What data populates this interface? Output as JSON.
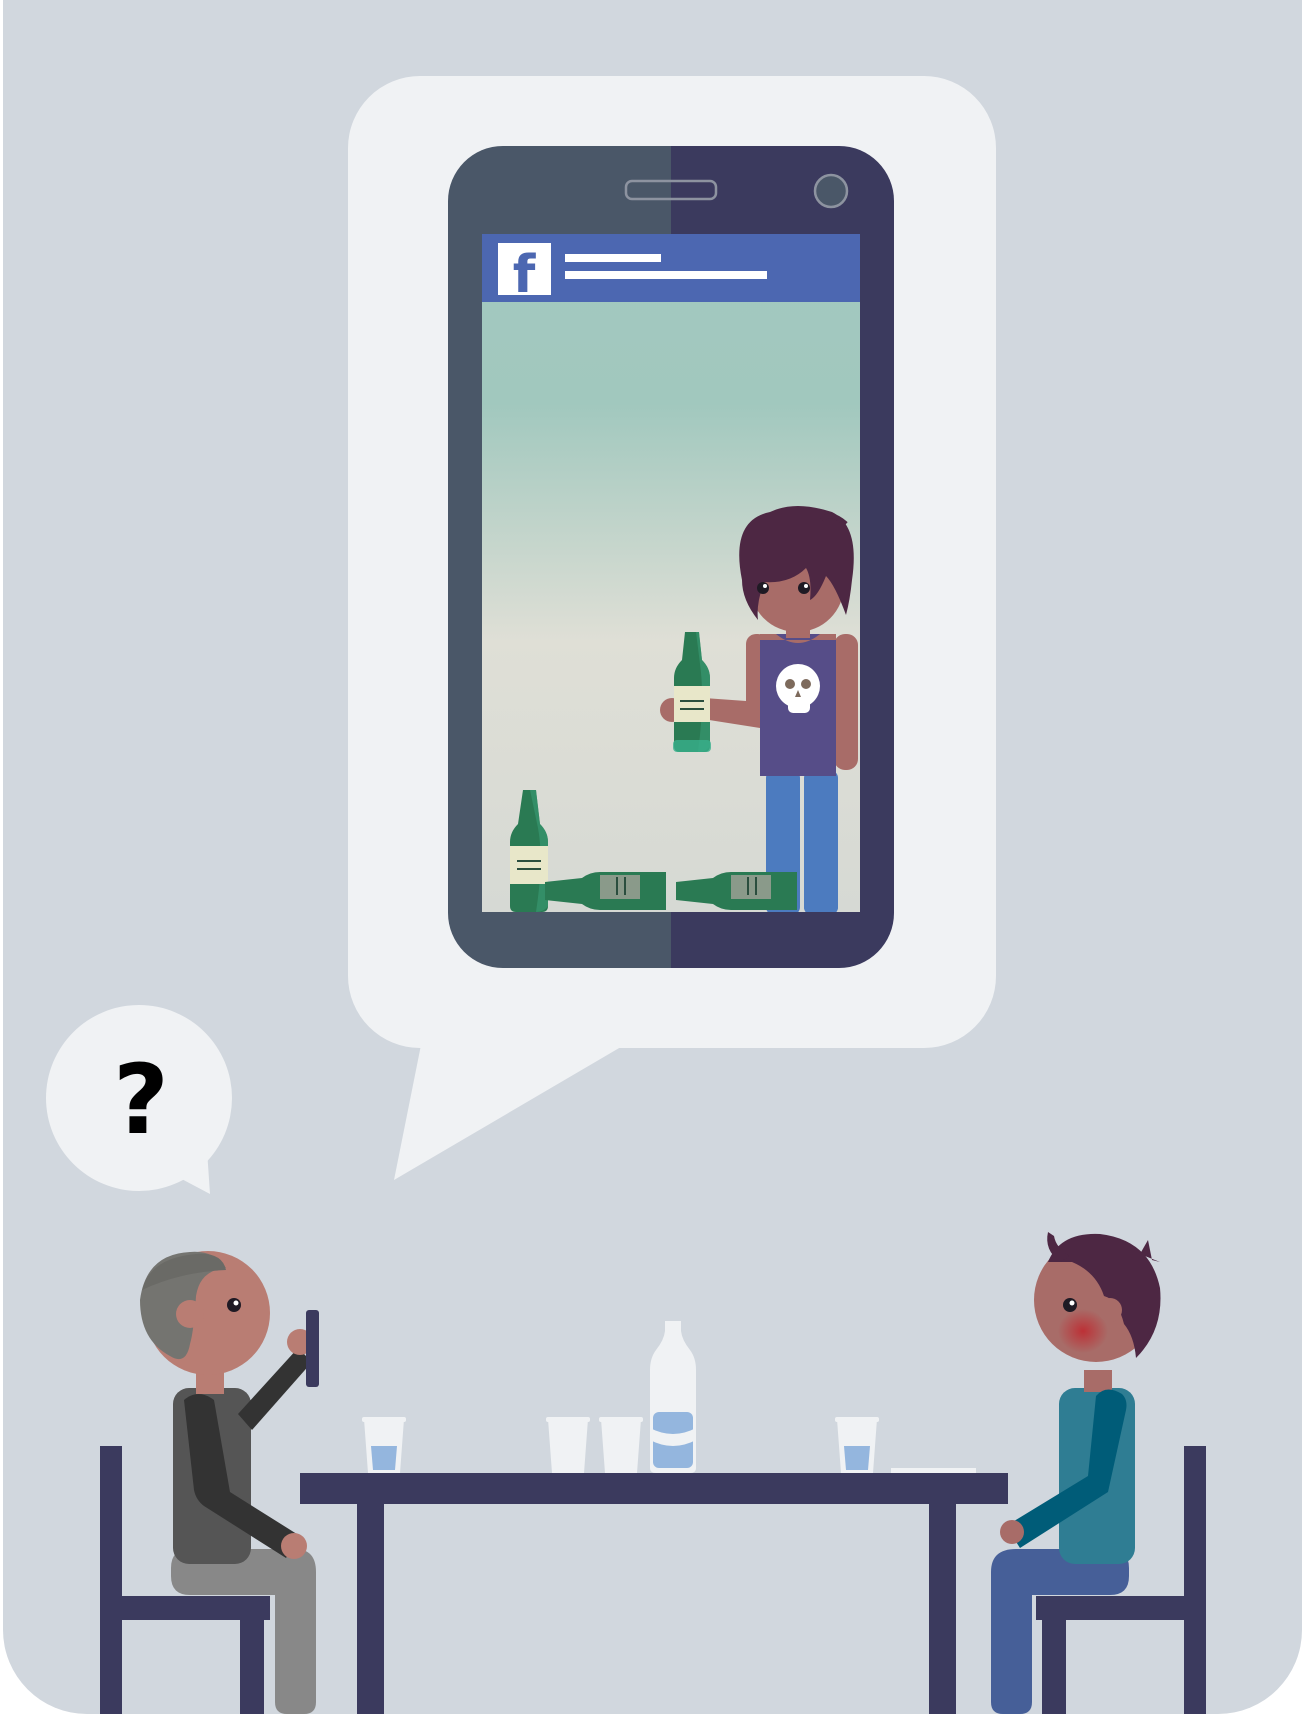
{
  "colors": {
    "background": "#d1d7de",
    "bubble": "#f0f2f4",
    "phone_left": "#4a5768",
    "phone_right": "#3b3a5e",
    "facebook_blue": "#4c67b1",
    "furniture": "#3b3a5e",
    "water": "#94b6de"
  },
  "thought_bubble": {
    "symbol": "?"
  },
  "phone": {
    "app_logo_letter": "f",
    "app_icon": "facebook-icon"
  },
  "illustration": {
    "people": [
      "man-with-phone",
      "boy-blushing",
      "teen-with-bottle"
    ],
    "objects": [
      "table",
      "chair-left",
      "chair-right",
      "water-bottle",
      "glasses",
      "beer-bottles"
    ]
  }
}
